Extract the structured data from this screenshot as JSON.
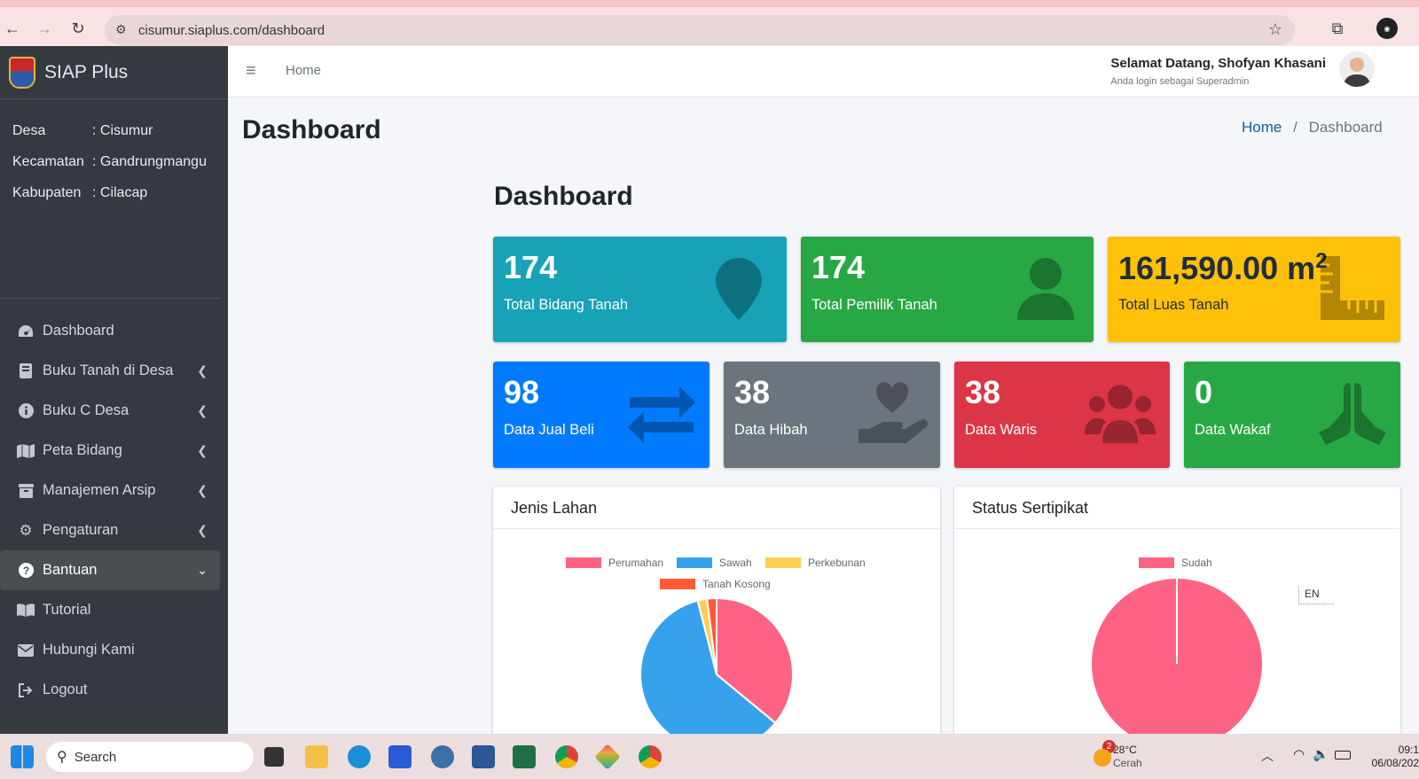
{
  "browser": {
    "url": "cisumur.siaplus.com/dashboard"
  },
  "sidebar": {
    "brand": "SIAP Plus",
    "location": [
      {
        "key": "Desa",
        "value": ": Cisumur"
      },
      {
        "key": "Kecamatan",
        "value": ": Gandrungmangu"
      },
      {
        "key": "Kabupaten",
        "value": ": Cilacap"
      }
    ],
    "menu": [
      {
        "label": "Dashboard",
        "icon": "tachometer-icon"
      },
      {
        "label": "Buku Tanah di Desa",
        "icon": "book-icon"
      },
      {
        "label": "Buku C Desa",
        "icon": "info-icon"
      },
      {
        "label": "Peta Bidang",
        "icon": "map-icon"
      },
      {
        "label": "Manajemen Arsip",
        "icon": "archive-icon"
      },
      {
        "label": "Pengaturan",
        "icon": "gears-icon"
      },
      {
        "label": "Bantuan",
        "icon": "question-icon"
      },
      {
        "label": "Tutorial",
        "icon": "book-open-icon"
      },
      {
        "label": "Hubungi Kami",
        "icon": "envelope-icon"
      },
      {
        "label": "Logout",
        "icon": "logout-icon"
      }
    ]
  },
  "topnav": {
    "home": "Home",
    "welcome": "Selamat Datang, Shofyan Khasani",
    "role": "Anda login sebagai Superadmin"
  },
  "page": {
    "title": "Dashboard",
    "breadcrumb_home": "Home",
    "breadcrumb_sep": "/",
    "breadcrumb_current": "Dashboard",
    "inner_title": "Dashboard"
  },
  "stats": {
    "bidang": {
      "value": "174",
      "label": "Total Bidang Tanah",
      "color": "#17a2b8"
    },
    "pemilik": {
      "value": "174",
      "label": "Total Pemilik Tanah",
      "color": "#28a745"
    },
    "luas": {
      "value": "161,590.00 m",
      "sup": "2",
      "label": "Total Luas Tanah",
      "color": "#ffc107"
    },
    "jual": {
      "value": "98",
      "label": "Data Jual Beli",
      "color": "#007bff"
    },
    "hibah": {
      "value": "38",
      "label": "Data Hibah",
      "color": "#6c757d"
    },
    "waris": {
      "value": "38",
      "label": "Data Waris",
      "color": "#dc3545"
    },
    "wakaf": {
      "value": "0",
      "label": "Data Wakaf",
      "color": "#28a745"
    }
  },
  "cards": {
    "jenis": "Jenis Lahan",
    "status": "Status Sertipikat",
    "en": "EN"
  },
  "chart_data": [
    {
      "type": "pie",
      "categories": [
        "Perumahan",
        "Sawah",
        "Perkebunan",
        "Tanah Kosong"
      ],
      "values": [
        36,
        60,
        2,
        2
      ],
      "colors": [
        "#ff6384",
        "#36a2eb",
        "#ffcd56",
        "#ff5a36"
      ]
    },
    {
      "type": "pie",
      "categories": [
        "Sudah"
      ],
      "values": [
        100
      ],
      "colors": [
        "#ff6384"
      ]
    }
  ],
  "taskbar": {
    "search": "Search",
    "temp": "28°C",
    "weather": "Cerah",
    "badge": "2",
    "time": "09:1",
    "date": "06/08/202"
  }
}
